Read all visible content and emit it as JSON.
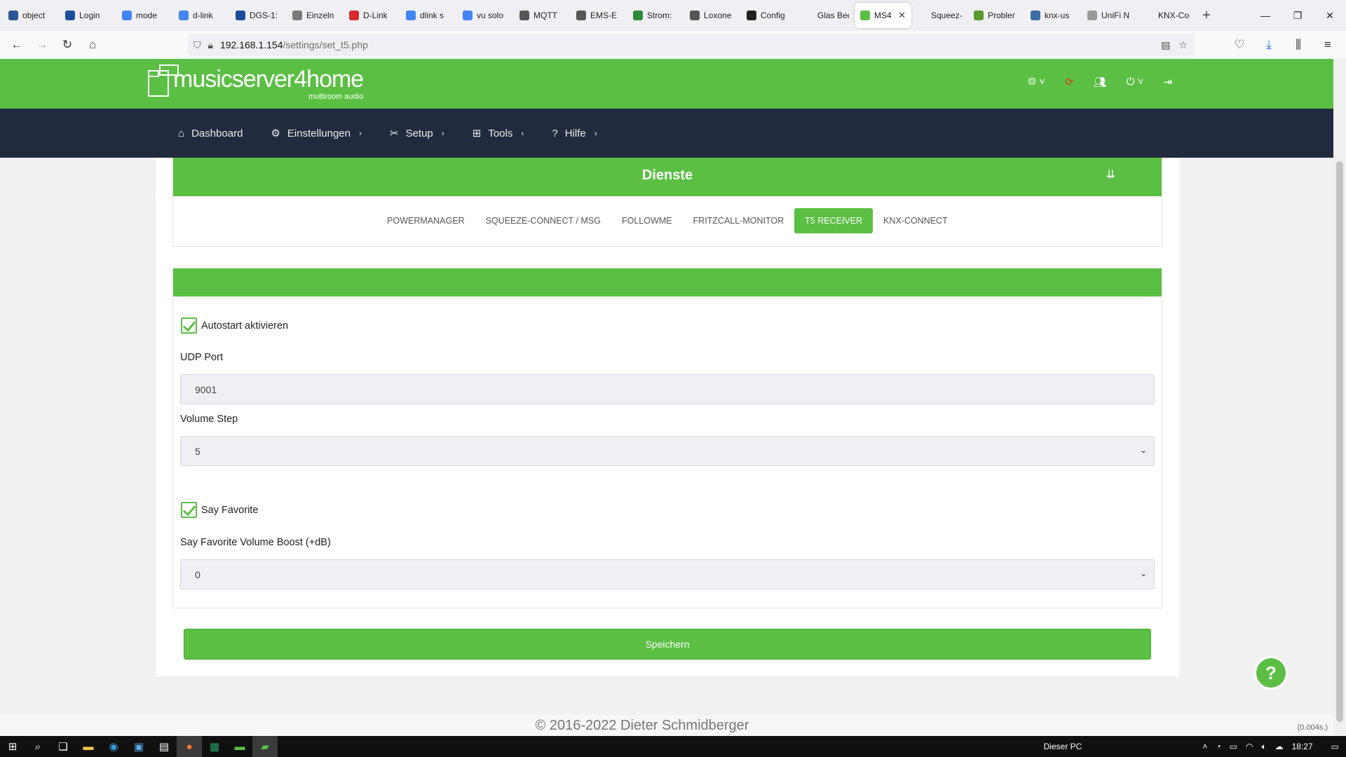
{
  "browser": {
    "tabs": [
      {
        "label": "object",
        "icon": "info-icon",
        "color": "#2b5797"
      },
      {
        "label": "Login",
        "icon": "dlink-icon",
        "color": "#1b4f9c"
      },
      {
        "label": "mode",
        "icon": "google-icon",
        "color": "#4285f4"
      },
      {
        "label": "d-link",
        "icon": "google-icon",
        "color": "#4285f4"
      },
      {
        "label": "DGS-1:",
        "icon": "dlink-icon",
        "color": "#1b4f9c"
      },
      {
        "label": "Einzeln",
        "icon": "doc-icon",
        "color": "#7a7a7a"
      },
      {
        "label": "D-Link",
        "icon": "zdnet-icon",
        "color": "#d62b2b"
      },
      {
        "label": "dlink s",
        "icon": "google-icon",
        "color": "#4285f4"
      },
      {
        "label": "vu solo",
        "icon": "google-icon",
        "color": "#4285f4"
      },
      {
        "label": "MQTT",
        "icon": "device-icon",
        "color": "#555555"
      },
      {
        "label": "EMS-E",
        "icon": "device-icon",
        "color": "#555555"
      },
      {
        "label": "Strom:",
        "icon": "house-icon",
        "color": "#2e8b3a"
      },
      {
        "label": "Loxone",
        "icon": "device-icon",
        "color": "#555555"
      },
      {
        "label": "Config",
        "icon": "gear-icon",
        "color": "#222222"
      },
      {
        "label": "Glas Bedien",
        "icon": "blank-icon",
        "color": "#f0f0f4"
      },
      {
        "label": "MS4",
        "icon": "ms4-icon",
        "color": "#5bbf44",
        "active": true
      },
      {
        "label": "Squeez-Co",
        "icon": "blank-icon",
        "color": "#f0f0f4"
      },
      {
        "label": "Probler",
        "icon": "arrow-icon",
        "color": "#5a9a2e"
      },
      {
        "label": "knx-us",
        "icon": "knx-icon",
        "color": "#3a6ea5"
      },
      {
        "label": "UniFi N",
        "icon": "dash-icon",
        "color": "#999999"
      },
      {
        "label": "KNX-Conn",
        "icon": "blank-icon",
        "color": "#f0f0f4"
      }
    ],
    "url_host": "192.168.1.154",
    "url_path": "/settings/set_t5.php"
  },
  "app": {
    "brand": "musicserver4home",
    "brand_sub": "multiroom audio",
    "menu": [
      {
        "label": "Dashboard",
        "icon": "home-icon",
        "glyph": "⌂",
        "chevron": false
      },
      {
        "label": "Einstellungen",
        "icon": "gear-icon",
        "glyph": "⚙",
        "chevron": true
      },
      {
        "label": "Setup",
        "icon": "wrench-icon",
        "glyph": "✂",
        "chevron": true
      },
      {
        "label": "Tools",
        "icon": "plus-square-icon",
        "glyph": "⊞",
        "chevron": true
      },
      {
        "label": "Hilfe",
        "icon": "question-icon",
        "glyph": "?",
        "chevron": true
      }
    ]
  },
  "page": {
    "section_title": "Dienste",
    "subtabs": [
      {
        "label": "POWERMANAGER",
        "active": false
      },
      {
        "label": "SQUEEZE-CONNECT / MSG",
        "active": false
      },
      {
        "label": "FOLLOWME",
        "active": false
      },
      {
        "label": "FRITZCALL-MONITOR",
        "active": false
      },
      {
        "label": "T5 RECEIVER",
        "active": true
      },
      {
        "label": "KNX-CONNECT",
        "active": false
      }
    ],
    "form": {
      "autostart_label": "Autostart aktivieren",
      "autostart_checked": true,
      "udp_port_label": "UDP Port",
      "udp_port_value": "9001",
      "volume_step_label": "Volume Step",
      "volume_step_value": "5",
      "say_favorite_label": "Say Favorite",
      "say_favorite_checked": true,
      "boost_label": "Say Favorite Volume Boost (+dB)",
      "boost_value": "0"
    },
    "save_label": "Speichern",
    "help_label": "?"
  },
  "footer": {
    "copyright": "© 2016-2022 Dieter Schmidberger",
    "timer": "(0.004s.)"
  },
  "taskbar": {
    "tray_label": "Dieser PC",
    "time": "18:27"
  },
  "colors": {
    "accent": "#5bbf44",
    "menu_bg": "#222b3d"
  }
}
